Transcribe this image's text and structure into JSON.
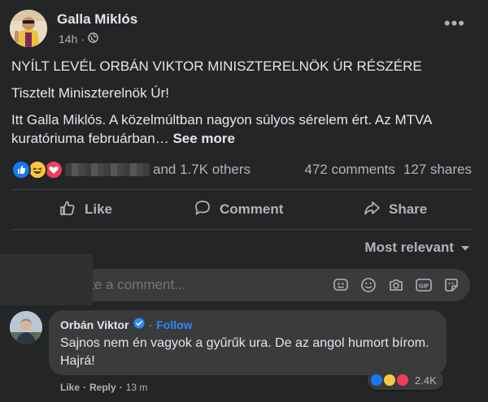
{
  "post": {
    "author": "Galla Miklós",
    "time": "14h",
    "lines": [
      "NYÍLT LEVÉL ORBÁN VIKTOR MINISZTERELNÖK ÚR RÉSZÉRE",
      "Tisztelt Miniszterelnök Úr!",
      "Itt Galla Miklós. A közelmúltban nagyon súlyos sérelem ért. Az MTVA",
      "kuratóriuma februárban…"
    ],
    "see_more": "See more",
    "reactions_others": "and 1.7K others",
    "comments_count": "472 comments",
    "shares_count": "127 shares",
    "actions": {
      "like": "Like",
      "comment": "Comment",
      "share": "Share"
    },
    "sort_label": "Most relevant",
    "comment_placeholder": "Write a comment..."
  },
  "comment": {
    "author": "Orbán Viktor",
    "follow": "Follow",
    "text": "Sajnos nem én vagyok a gyűrűk ura. De az angol humort bírom. Hajrá!",
    "reaction_count": "2.4K",
    "like": "Like",
    "reply": "Reply",
    "sep": "·",
    "time": "13 m"
  },
  "colors": {
    "background": "#242526",
    "bubble": "#3a3b3c",
    "accent": "#2d88ff",
    "like_reaction": "#1877f2",
    "haha_reaction": "#f7c842",
    "love_reaction": "#f33e58"
  },
  "icons": [
    "globe-icon",
    "more-icon",
    "like-icon",
    "comment-icon",
    "share-icon",
    "chevron-down-icon",
    "sticker-face-icon",
    "emoji-icon",
    "camera-icon",
    "gif-icon",
    "sticker-icon",
    "verified-badge-icon"
  ]
}
